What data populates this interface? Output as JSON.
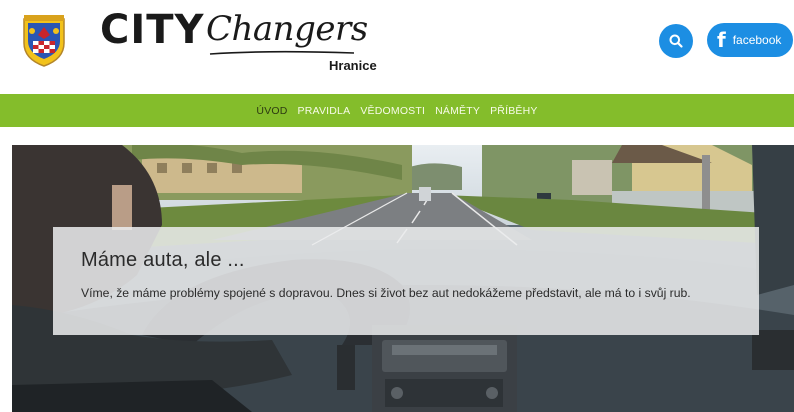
{
  "header": {
    "logo_city": "CITY",
    "logo_changers": "Changers",
    "logo_subtitle": "Hranice",
    "search_icon": "search-icon",
    "facebook_label": "facebook",
    "facebook_icon": "facebook-icon"
  },
  "nav": {
    "items": [
      {
        "label": "ÚVOD",
        "active": true
      },
      {
        "label": "PRAVIDLA",
        "active": false
      },
      {
        "label": "VĚDOMOSTI",
        "active": false
      },
      {
        "label": "NÁMĚTY",
        "active": false
      },
      {
        "label": "PŘÍBĚHY",
        "active": false
      }
    ]
  },
  "hero": {
    "title": "Máme auta, ale ...",
    "text": "Víme, že máme problémy spojené s dopravou. Dnes si život bez aut nedokážeme představit, ale má to i svůj rub."
  },
  "colors": {
    "accent_green": "#84bd2b",
    "accent_blue": "#1c8ee3",
    "nav_active": "#2d3a12"
  }
}
